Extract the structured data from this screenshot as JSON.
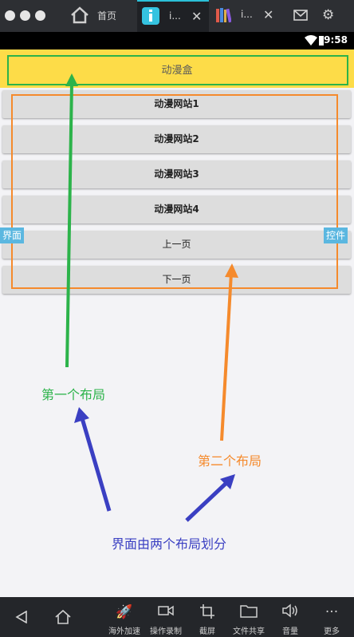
{
  "emulator": {
    "tabs": [
      {
        "label": "首页",
        "icon": "home-icon"
      },
      {
        "label": "i...",
        "icon": "app-icon"
      },
      {
        "label": "i...",
        "icon": "books-icon"
      }
    ],
    "toolbar_icons": [
      "mail-icon",
      "gear-icon"
    ],
    "bottom_bar": [
      {
        "label": "",
        "icon": "back-icon"
      },
      {
        "label": "",
        "icon": "home-icon"
      },
      {
        "label": "海外加速",
        "icon": "rocket-icon"
      },
      {
        "label": "操作录制",
        "icon": "video-icon"
      },
      {
        "label": "截屏",
        "icon": "crop-icon"
      },
      {
        "label": "文件共享",
        "icon": "folder-icon"
      },
      {
        "label": "音量",
        "icon": "volume-icon"
      },
      {
        "label": "更多",
        "icon": "more-icon"
      }
    ]
  },
  "status_bar": {
    "time": "9:58"
  },
  "app": {
    "title": "动漫盒",
    "buttons": [
      "动漫网站1",
      "动漫网站2",
      "动漫网站3",
      "动漫网站4",
      "上一页",
      "下一页"
    ]
  },
  "annotations": {
    "left_badge": "界面",
    "right_badge": "控件",
    "green_note": "第一个布局",
    "orange_note": "第二个布局",
    "blue_note": "界面由两个布局划分"
  },
  "colors": {
    "title_bg": "#fddc48",
    "green": "#2cb34a",
    "orange": "#f58a2c",
    "blue": "#3a3fc2",
    "badge": "#5bb7e0"
  }
}
